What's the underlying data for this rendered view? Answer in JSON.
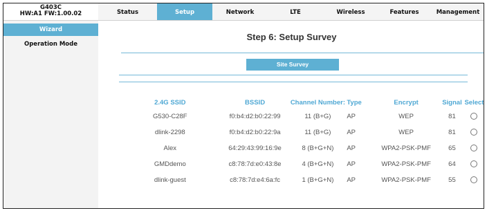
{
  "header": {
    "device_model": "G403C",
    "hw_fw": "HW:A1   FW:1.00.02"
  },
  "nav": {
    "tabs": [
      {
        "label": "Status"
      },
      {
        "label": "Setup"
      },
      {
        "label": "Network"
      },
      {
        "label": "LTE"
      },
      {
        "label": "Wireless"
      },
      {
        "label": "Features"
      },
      {
        "label": "Management"
      }
    ],
    "active": "Setup"
  },
  "sidebar": {
    "items": [
      {
        "label": "Wizard"
      },
      {
        "label": "Operation Mode"
      }
    ],
    "active": "Wizard"
  },
  "main": {
    "title": "Step 6: Setup Survey",
    "site_survey_label": "Site Survey"
  },
  "table": {
    "headers": [
      "2.4G SSID",
      "BSSID",
      "Channel Number:",
      "Type",
      "Encrypt",
      "Signal",
      "Select"
    ],
    "rows": [
      [
        "G530-C28F",
        "f0:b4:d2:b0:22:99",
        "11 (B+G)",
        "AP",
        "WEP",
        "81"
      ],
      [
        "dlink-2298",
        "f0:b4:d2:b0:22:9a",
        "11 (B+G)",
        "AP",
        "WEP",
        "81"
      ],
      [
        "Alex",
        "64:29:43:99:16:9e",
        "8 (B+G+N)",
        "AP",
        "WPA2-PSK-PMF",
        "65"
      ],
      [
        "GMDdemo",
        "c8:78:7d:e0:43:8e",
        "4 (B+G+N)",
        "AP",
        "WPA2-PSK-PMF",
        "64"
      ],
      [
        "dlink-guest",
        "c8:78:7d:e4:6a:fc",
        "1 (B+G+N)",
        "AP",
        "WPA2-PSK-PMF",
        "55"
      ]
    ]
  },
  "colors": {
    "accent": "#5eb0d3",
    "header_text": "#4fa8d4",
    "divider": "#74b8d8"
  },
  "icons": {
    "select_control": "radio-button"
  }
}
